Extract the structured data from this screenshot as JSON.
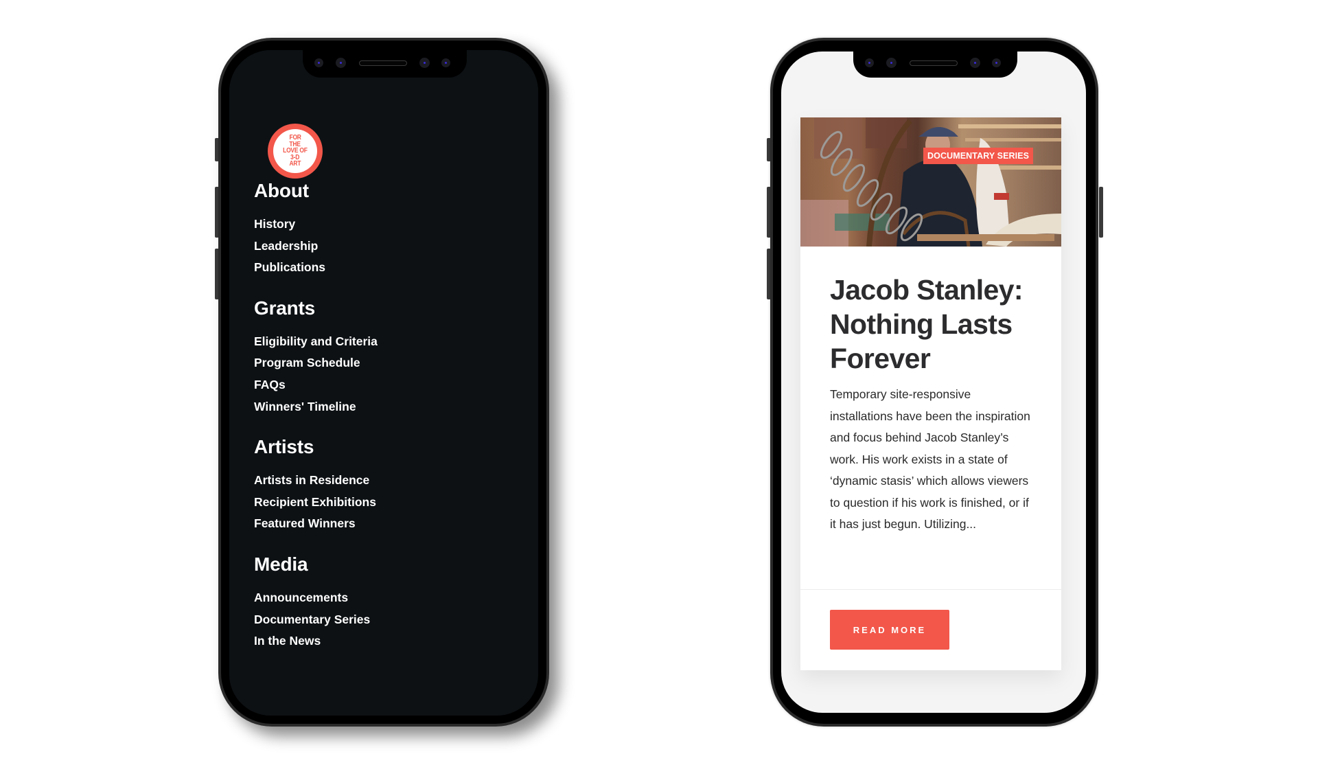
{
  "left_phone": {
    "logo": {
      "lines": [
        "FOR",
        "THE",
        "LOVE OF",
        "3-D",
        "ART"
      ],
      "accent_color": "#f2574a"
    },
    "nav": [
      {
        "heading": "About",
        "items": [
          "History",
          "Leadership",
          "Publications"
        ]
      },
      {
        "heading": "Grants",
        "items": [
          "Eligibility and Criteria",
          "Program Schedule",
          "FAQs",
          "Winners' Timeline"
        ]
      },
      {
        "heading": "Artists",
        "items": [
          "Artists in Residence",
          "Recipient Exhibitions",
          "Featured Winners"
        ]
      },
      {
        "heading": "Media",
        "items": [
          "Announcements",
          "Documentary Series",
          "In the News"
        ]
      }
    ],
    "background_color": "#0d1114"
  },
  "right_phone": {
    "card": {
      "image_alt": "Artist in workshop with coiled metal sculpture",
      "badge": "DOCUMENTARY SERIES",
      "title": "Jacob Stanley: Nothing Lasts Forever",
      "excerpt": "Temporary site-responsive installations have been the inspiration and focus behind Jacob Stanley’s work. His work exists in a state of ‘dynamic stasis’ which allows viewers to question if his work is finished, or if it has just begun. Utilizing...",
      "button_label": "READ MORE"
    },
    "accent_color": "#f2574a"
  }
}
